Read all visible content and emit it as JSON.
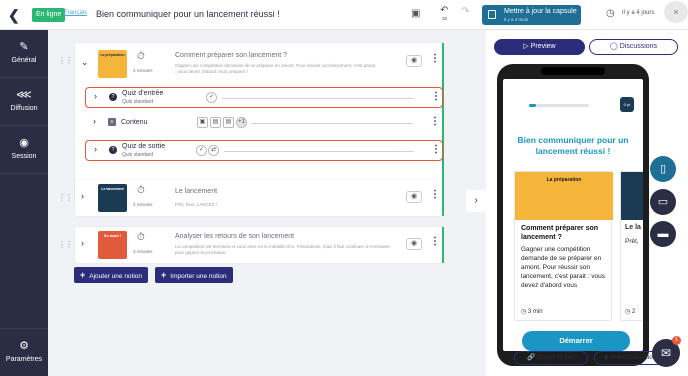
{
  "topbar": {
    "back_icon": "chevron-left-icon",
    "status_badge": "En ligne",
    "language": "Français",
    "page_title": "Bien communiquer pour un lancement réussi !",
    "undo_count": "35",
    "update_button": "Mettre à jour la capsule",
    "update_sub": "Il y a 4 mois",
    "last_update": "Il y a 4 jours",
    "close": "×"
  },
  "sidebar": {
    "items": [
      {
        "label": "Général",
        "icon": "wrench-icon"
      },
      {
        "label": "Diffusion",
        "icon": "share-icon"
      },
      {
        "label": "Session",
        "icon": "target-icon"
      }
    ],
    "bottom": {
      "label": "Paramètres",
      "icon": "gear-icon"
    }
  },
  "modules": [
    {
      "title": "Comment préparer son lancement ?",
      "desc": "Gagner une compétition demande de se préparer en amont. Pour réussir son lancement, c'est parait : vous devez d'abord vous préparer !",
      "duration": "3 minutes",
      "thumb_color": "#f5b43a",
      "thumb_text": "La préparation"
    },
    {
      "title": "Le lancement",
      "desc": "Prêt, feux, LANCEZ !",
      "duration": "2 minutes",
      "thumb_color": "#1b3b55",
      "thumb_text": "Le lancement"
    },
    {
      "title": "Analyser les retours de son lancement",
      "desc": "La compétition est terminée et vous avez eu la médaille d'or. Félicitations, mais il faut continuer à s'entrainer pour gagner la prochaine.",
      "duration": "3 minutes",
      "thumb_color": "#e05a3b",
      "thumb_text": "En avant !"
    }
  ],
  "subitems": [
    {
      "title": "Quiz d'entrée",
      "subtitle": "Quiz standard"
    },
    {
      "title": "Contenu",
      "subtitle": "",
      "more": "+1"
    },
    {
      "title": "Quiz de sortie",
      "subtitle": "Quiz standard"
    }
  ],
  "actions": {
    "add_notion": "Ajouter une notion",
    "import_notion": "Importer une notion"
  },
  "preview": {
    "tab_preview": "Preview",
    "tab_discussions": "Discussions",
    "points": "0 pt",
    "progress": 0.12,
    "capsule_title": "Bien communiquer pour un lancement réussi !",
    "card1": {
      "image_label": "La préparation",
      "title": "Comment préparer son lancement ?",
      "text": "Gagner une compétition demande de se préparer en amont. Pour réussir son lancement, c'est parait : vous devez d'abord vous",
      "time": "3 min"
    },
    "card2": {
      "title": "Le la",
      "text": "Prêt,",
      "time": "2"
    },
    "start_button": "Démarrer",
    "copy_link": "Copier le lien",
    "preview_link": "Prévisualisation",
    "chat_badge": "1"
  }
}
